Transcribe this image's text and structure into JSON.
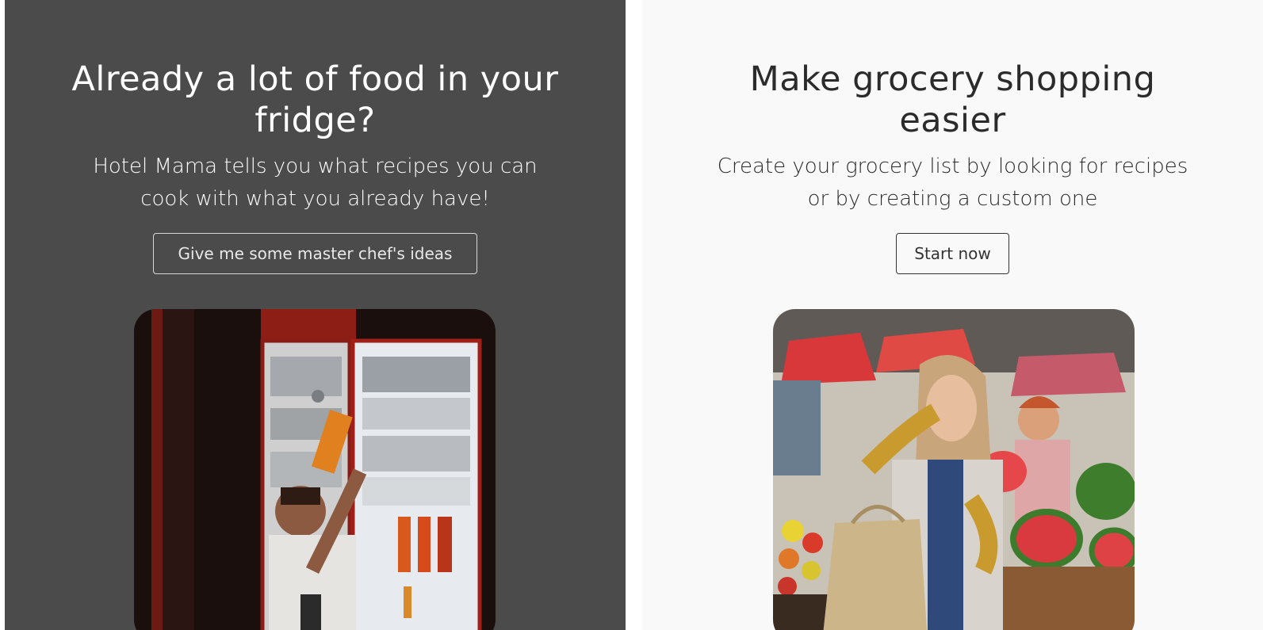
{
  "left_section": {
    "title": "Already a lot of food in your fridge?",
    "subtitle": "Hotel Mama tells you what recipes you can cook with what you already have!",
    "button_label": "Give me some master chef's ideas",
    "image_alt": "fridge-photo"
  },
  "right_section": {
    "title": "Make grocery shopping easier",
    "subtitle": "Create your grocery list by looking for recipes or by creating a custom one",
    "button_label": "Start now",
    "image_alt": "market-photo"
  },
  "colors": {
    "left_background": "#4b4b4b",
    "right_background": "#f9f9f9",
    "left_text": "#ffffff",
    "right_text": "#2b2b2b"
  }
}
